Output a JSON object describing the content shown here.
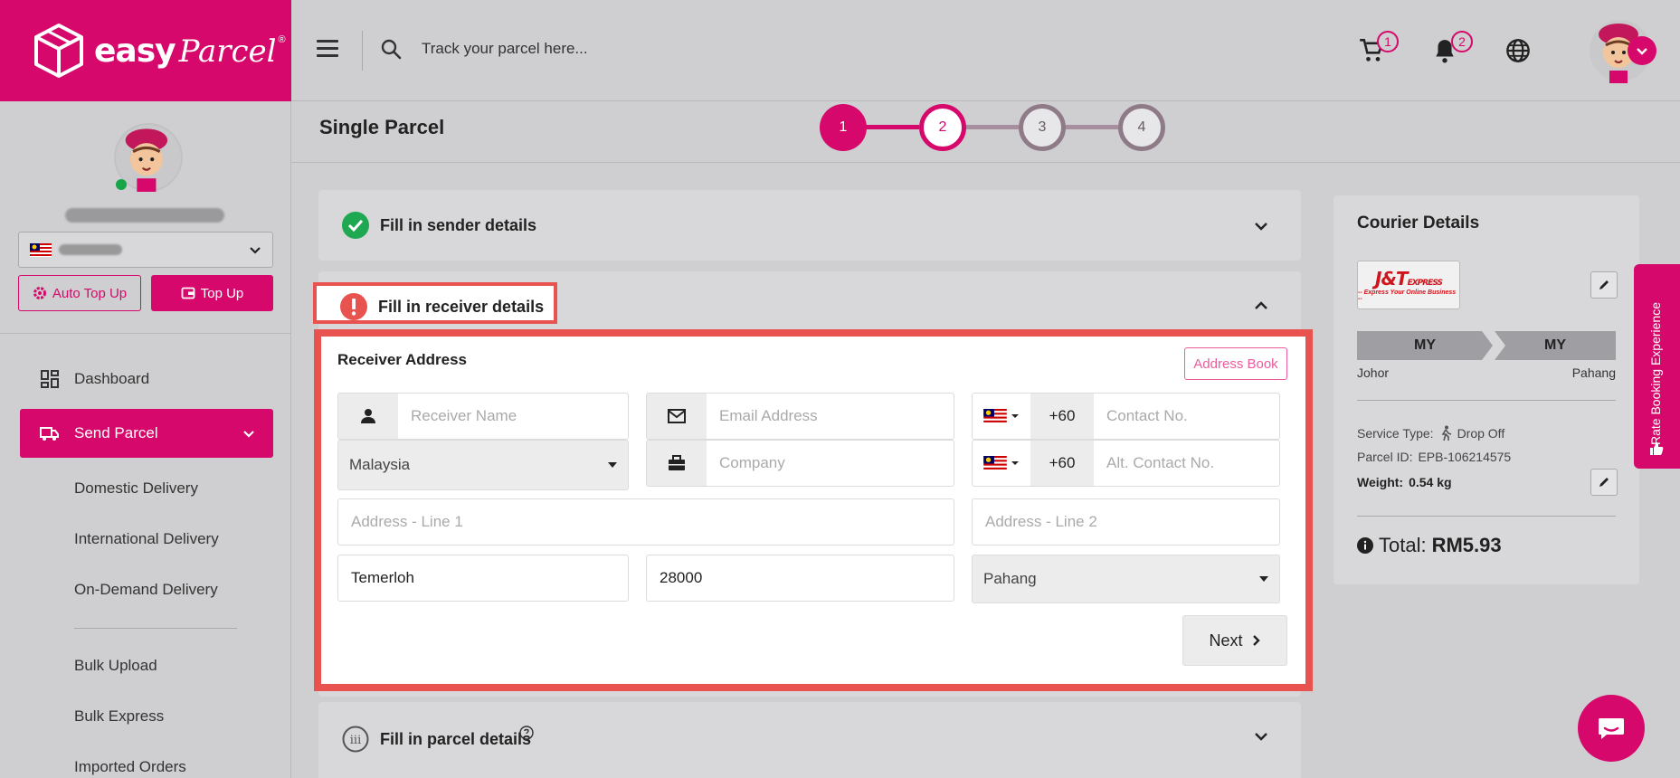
{
  "brand": {
    "name_bold": "easy",
    "name_script": "Parcel",
    "reg": "®"
  },
  "topbar": {
    "search_placeholder": "Track your parcel here...",
    "cart_count": "1",
    "notif_count": "2"
  },
  "sidebar": {
    "auto_topup_label": "Auto Top Up",
    "topup_label": "Top Up",
    "nav": {
      "dashboard": "Dashboard",
      "send_parcel": "Send Parcel",
      "sub": {
        "domestic": "Domestic Delivery",
        "international": "International Delivery",
        "on_demand": "On-Demand Delivery",
        "bulk_upload": "Bulk Upload",
        "bulk_express": "Bulk Express",
        "imported": "Imported Orders"
      }
    }
  },
  "main": {
    "title": "Single Parcel",
    "steps": [
      "1",
      "2",
      "3",
      "4"
    ],
    "sender_section": "Fill in sender details",
    "receiver_section": "Fill in receiver details",
    "parcel_section": "Fill in parcel details"
  },
  "receiver": {
    "title": "Receiver Address",
    "address_book": "Address Book",
    "name_placeholder": "Receiver Name",
    "email_placeholder": "Email Address",
    "phone_code": "+60",
    "phone_placeholder": "Contact No.",
    "country": "Malaysia",
    "company_placeholder": "Company",
    "alt_code": "+60",
    "alt_phone_placeholder": "Alt. Contact No.",
    "addr1_placeholder": "Address - Line 1",
    "addr2_placeholder": "Address - Line 2",
    "city": "Temerloh",
    "postcode": "28000",
    "state": "Pahang",
    "next_label": "Next"
  },
  "courier": {
    "title": "Courier Details",
    "logo_main": "J&T",
    "logo_express": "EXPRESS",
    "logo_tagline": "-- Express Your Online Business --",
    "from_country": "MY",
    "to_country": "MY",
    "from_state": "Johor",
    "to_state": "Pahang",
    "service_label": "Service Type:",
    "service_value": "Drop Off",
    "parcel_id_label": "Parcel ID:",
    "parcel_id": "EPB-106214575",
    "weight_label": "Weight:",
    "weight_value": "0.54 kg",
    "total_label": "Total:",
    "total_value": "RM5.93"
  },
  "rate_tab": "Rate Booking Experience",
  "colors": {
    "brand": "#d6086b",
    "highlight": "#e9534f",
    "success": "#1da851"
  }
}
